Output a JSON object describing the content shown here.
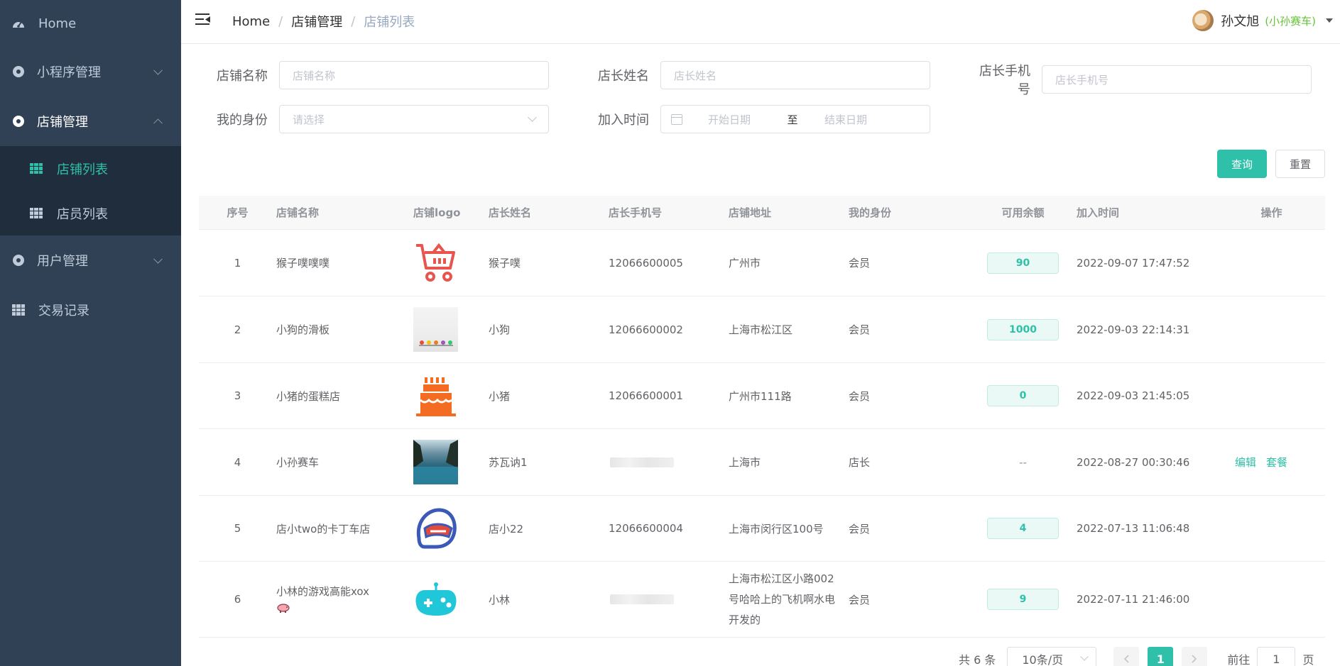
{
  "sidebar": {
    "home": "Home",
    "miniprogram": "小程序管理",
    "store_mgmt": "店铺管理",
    "store_list": "店铺列表",
    "staff_list": "店员列表",
    "user_mgmt": "用户管理",
    "trade_log": "交易记录"
  },
  "header": {
    "breadcrumb": [
      "Home",
      "店铺管理",
      "店铺列表"
    ],
    "user_name": "孙文旭",
    "user_tag": "(小孙赛车)"
  },
  "filters": {
    "store_name_label": "店铺名称",
    "store_name_placeholder": "店铺名称",
    "owner_name_label": "店长姓名",
    "owner_name_placeholder": "店长姓名",
    "owner_phone_label": "店长手机号",
    "owner_phone_placeholder": "店长手机号",
    "role_label": "我的身份",
    "role_placeholder": "请选择",
    "join_label": "加入时间",
    "start_placeholder": "开始日期",
    "range_sep": "至",
    "end_placeholder": "结束日期",
    "query_btn": "查询",
    "reset_btn": "重置"
  },
  "table": {
    "headers": [
      "序号",
      "店铺名称",
      "店铺logo",
      "店长姓名",
      "店长手机号",
      "店铺地址",
      "我的身份",
      "可用余额",
      "加入时间",
      "操作"
    ],
    "rows": [
      {
        "idx": "1",
        "name": "猴子噗噗噗",
        "logo": "cart",
        "owner": "猴子噗",
        "phone": "12066600005",
        "addr": "广州市",
        "role": "会员",
        "balance": "90",
        "time": "2022-09-07 17:47:52"
      },
      {
        "idx": "2",
        "name": "小狗的滑板",
        "logo": "photo-white",
        "owner": "小狗",
        "phone": "12066600002",
        "addr": "上海市松江区",
        "role": "会员",
        "balance": "1000",
        "time": "2022-09-03 22:14:31"
      },
      {
        "idx": "3",
        "name": "小猪的蛋糕店",
        "logo": "cake",
        "owner": "小猪",
        "phone": "12066600001",
        "addr": "广州市111路",
        "role": "会员",
        "balance": "0",
        "time": "2022-09-03 21:45:05"
      },
      {
        "idx": "4",
        "name": "小孙赛车",
        "logo": "photo-sea",
        "owner": "苏瓦讷1",
        "phone": "",
        "addr": "上海市",
        "role": "店长",
        "balance_text": "--",
        "time": "2022-08-27 00:30:46",
        "ops": [
          "编辑",
          "套餐"
        ]
      },
      {
        "idx": "5",
        "name": "店小two的卡丁车店",
        "logo": "helmet",
        "owner": "店小22",
        "phone": "12066600004",
        "addr": "上海市闵行区100号",
        "role": "会员",
        "balance": "4",
        "time": "2022-07-13 11:06:48"
      },
      {
        "idx": "6",
        "name": "小林的游戏高能xox",
        "logo": "gamepad",
        "owner": "小林",
        "phone": "",
        "addr": "上海市松江区小路002号哈哈上的飞机啊水电开发的",
        "role": "会员",
        "balance": "9",
        "time": "2022-07-11 21:46:00"
      }
    ]
  },
  "pager": {
    "total": "共 6 条",
    "size": "10条/页",
    "page": "1",
    "goto": "前往",
    "goto_value": "1",
    "page_unit": "页"
  },
  "colors": {
    "accent": "#2ec0a8",
    "sidebar_bg": "#304156"
  }
}
